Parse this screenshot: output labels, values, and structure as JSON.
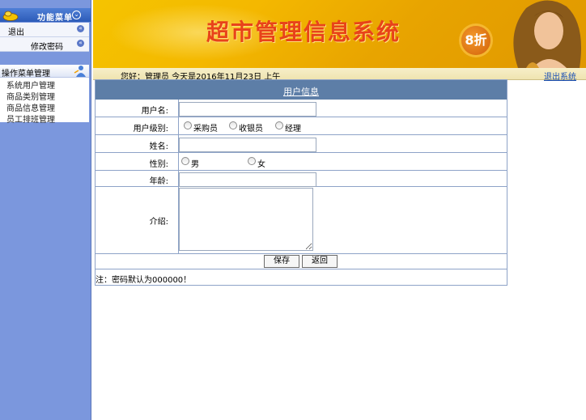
{
  "sidebar": {
    "function_menu_title": "功能菜单",
    "logout": "退出",
    "change_password": "修改密码",
    "ops_title": "操作菜单管理",
    "ops_items": [
      "系统用户管理",
      "商品类别管理",
      "商品信息管理",
      "员工排班管理"
    ],
    "chevron_glyph": "«",
    "collapse_glyph": "⌄"
  },
  "banner": {
    "title": "超市管理信息系统",
    "discount": "8折"
  },
  "greeting": {
    "text": "您好：管理员    今天是2016年11月23日      上午",
    "exit_system": "退出系统"
  },
  "form": {
    "header": "用户信息",
    "username_label": "用户名:",
    "userlevel_label": "用户级别:",
    "levels": [
      "采购员",
      "收银员",
      "经理"
    ],
    "name_label": "姓名:",
    "gender_label": "性别:",
    "genders": [
      "男",
      "女"
    ],
    "age_label": "年龄:",
    "intro_label": "介绍:",
    "username_value": "",
    "name_value": "",
    "age_value": "",
    "intro_value": "",
    "save_label": "保存",
    "back_label": "返回"
  },
  "note": "注：密码默认为000000！"
}
